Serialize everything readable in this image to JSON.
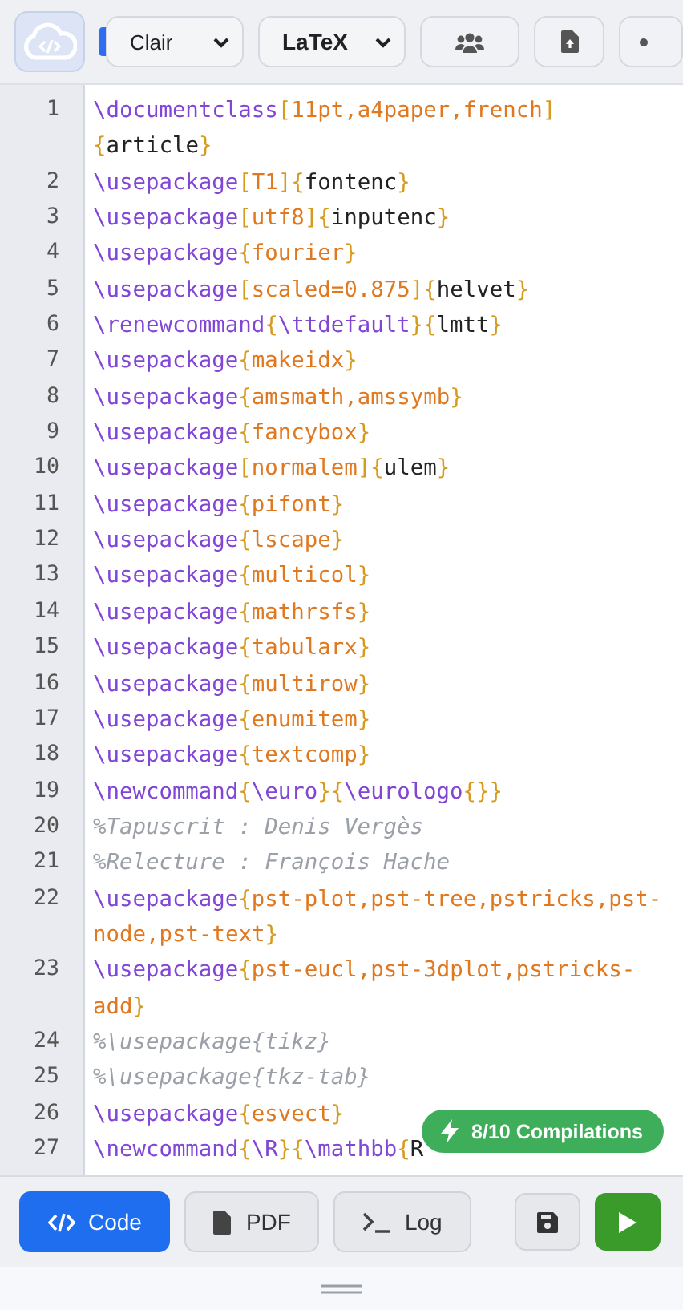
{
  "toolbar": {
    "theme_select": "Clair",
    "language_select": "LaTeX"
  },
  "editor": {
    "lines": [
      {
        "number": "1",
        "rows": [
          "\\documentclass[11pt,a4paper,french]",
          "{article}"
        ]
      },
      {
        "number": "2",
        "rows": [
          "\\usepackage[T1]{fontenc}"
        ]
      },
      {
        "number": "3",
        "rows": [
          "\\usepackage[utf8]{inputenc}"
        ]
      },
      {
        "number": "4",
        "rows": [
          "\\usepackage{fourier}"
        ]
      },
      {
        "number": "5",
        "rows": [
          "\\usepackage[scaled=0.875]{helvet}"
        ]
      },
      {
        "number": "6",
        "rows": [
          "\\renewcommand{\\ttdefault}{lmtt}"
        ]
      },
      {
        "number": "7",
        "rows": [
          "\\usepackage{makeidx}"
        ]
      },
      {
        "number": "8",
        "rows": [
          "\\usepackage{amsmath,amssymb}"
        ]
      },
      {
        "number": "9",
        "rows": [
          "\\usepackage{fancybox}"
        ]
      },
      {
        "number": "10",
        "rows": [
          "\\usepackage[normalem]{ulem}"
        ]
      },
      {
        "number": "11",
        "rows": [
          "\\usepackage{pifont}"
        ]
      },
      {
        "number": "12",
        "rows": [
          "\\usepackage{lscape}"
        ]
      },
      {
        "number": "13",
        "rows": [
          "\\usepackage{multicol}"
        ]
      },
      {
        "number": "14",
        "rows": [
          "\\usepackage{mathrsfs}"
        ]
      },
      {
        "number": "15",
        "rows": [
          "\\usepackage{tabularx}"
        ]
      },
      {
        "number": "16",
        "rows": [
          "\\usepackage{multirow}"
        ]
      },
      {
        "number": "17",
        "rows": [
          "\\usepackage{enumitem}"
        ]
      },
      {
        "number": "18",
        "rows": [
          "\\usepackage{textcomp}"
        ]
      },
      {
        "number": "19",
        "rows": [
          "\\newcommand{\\euro}{\\eurologo{}}"
        ]
      },
      {
        "number": "20",
        "rows": [
          "%Tapuscrit : Denis Vergès"
        ]
      },
      {
        "number": "21",
        "rows": [
          "%Relecture : François Hache"
        ]
      },
      {
        "number": "22",
        "rows": [
          "\\usepackage{pst-plot,pst-tree,pstricks,pst-",
          "node,pst-text}"
        ]
      },
      {
        "number": "23",
        "rows": [
          "\\usepackage{pst-eucl,pst-3dplot,pstricks-",
          "add}"
        ]
      },
      {
        "number": "24",
        "rows": [
          "%\\usepackage{tikz}"
        ]
      },
      {
        "number": "25",
        "rows": [
          "%\\usepackage{tkz-tab}"
        ]
      },
      {
        "number": "26",
        "rows": [
          "\\usepackage{esvect}"
        ]
      },
      {
        "number": "27",
        "rows": [
          "\\newcommand{\\R}{\\mathbb{R"
        ]
      }
    ]
  },
  "badge": {
    "text": "8/10 Compilations"
  },
  "bottom_bar": {
    "tabs": [
      {
        "label": "Code",
        "selected": true,
        "kind": "code"
      },
      {
        "label": "PDF",
        "selected": false,
        "kind": "pdf"
      },
      {
        "label": "Log",
        "selected": false,
        "kind": "log"
      }
    ]
  }
}
